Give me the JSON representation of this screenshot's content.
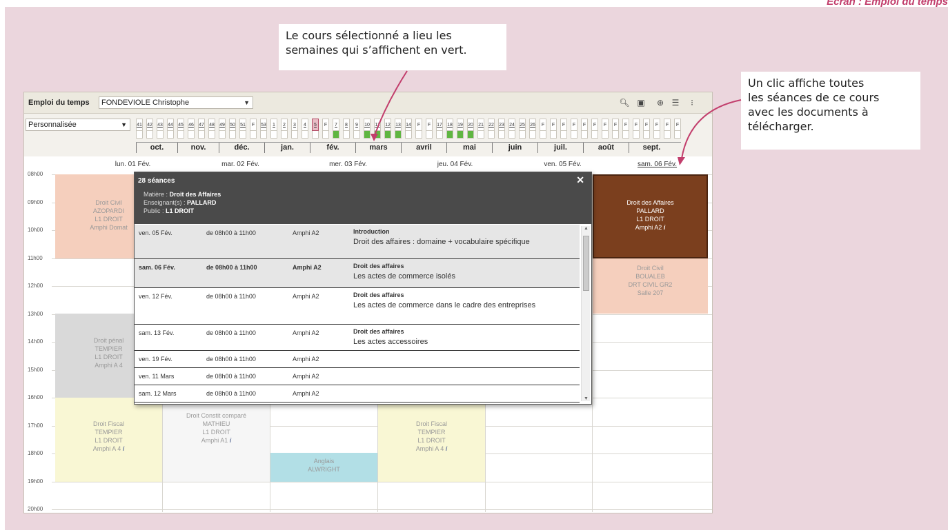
{
  "page_header": "Écran : Emploi du temps",
  "callouts": {
    "weeks": [
      "Le cours sélectionné a lieu les",
      "semaines qui s’affichent en vert."
    ],
    "click": [
      "Un clic affiche toutes",
      "les séances de ce cours",
      "avec les documents à",
      "télécharger."
    ]
  },
  "toolbar": {
    "title": "Emploi du temps",
    "teacher": "FONDEVIOLE Christophe",
    "view": "Personnalisée"
  },
  "weeks": [
    "41",
    "42",
    "43",
    "44",
    "45",
    "46",
    "47",
    "48",
    "49",
    "50",
    "51",
    "F",
    "53",
    "1",
    "2",
    "3",
    "4",
    "5",
    "F",
    "7",
    "8",
    "9",
    "10",
    "11",
    "12",
    "13",
    "14",
    "F",
    "F",
    "17",
    "18",
    "19",
    "20",
    "21",
    "22",
    "23",
    "24",
    "25",
    "26",
    "F",
    "F",
    "F",
    "F",
    "F",
    "F",
    "F",
    "F",
    "F",
    "F",
    "F",
    "F",
    "F",
    "F"
  ],
  "months": [
    "oct.",
    "nov.",
    "déc.",
    "jan.",
    "fév.",
    "mars",
    "avril",
    "mai",
    "juin",
    "juil.",
    "août",
    "sept."
  ],
  "days": [
    "lun. 01 Fév.",
    "mar. 02 Fév.",
    "mer. 03 Fév.",
    "jeu. 04 Fév.",
    "ven. 05 Fév.",
    "sam. 06 Fév."
  ],
  "hours": [
    "08h00",
    "09h00",
    "10h00",
    "11h00",
    "12h00",
    "13h00",
    "14h00",
    "15h00",
    "16h00",
    "17h00",
    "18h00",
    "19h00",
    "20h00"
  ],
  "events": {
    "mon_civil": [
      "Droit Civil",
      "AZOPARDI",
      "L1 DROIT",
      "Amphi Domat"
    ],
    "mon_penal": [
      "Droit pénal",
      "TEMPIER",
      "L1 DROIT",
      "Amphi A 4"
    ],
    "mon_fiscal": [
      "Droit Fiscal",
      "TEMPIER",
      "L1 DROIT",
      "Amphi A 4"
    ],
    "tue_constit": [
      "Droit Constit comparé",
      "MATHIEU",
      "L1 DROIT",
      "Amphi A1"
    ],
    "wed_anglais": [
      "Anglais",
      "ALWRIGHT"
    ],
    "thu_fiscal": [
      "Droit Fiscal",
      "TEMPIER",
      "L1 DROIT",
      "Amphi A 4"
    ],
    "sat_affaires": [
      "Droit des Affaires",
      "PALLARD",
      "L1 DROIT",
      "Amphi A2"
    ],
    "sat_civil": [
      "Droit Civil",
      "BOUALEB",
      "DRT CIVIL GR2",
      "Salle 207"
    ]
  },
  "popup": {
    "count": "28 séances",
    "matiere_label": "Matière :",
    "matiere": "Droit des Affaires",
    "enseignant_label": "Enseignant(s) :",
    "enseignant": "PALLARD",
    "public_label": "Public :",
    "public": "L1 DROIT",
    "close": "✕",
    "rows": [
      {
        "date": "ven. 05 Fév.",
        "time": "de 08h00 à 11h00",
        "room": "Amphi A2",
        "title": "Introduction",
        "desc": "Droit des affaires : domaine + vocabulaire spécifique"
      },
      {
        "date": "sam. 06 Fév.",
        "time": "de 08h00 à 11h00",
        "room": "Amphi A2",
        "title": "Droit des affaires",
        "desc": "Les actes de commerce isolés"
      },
      {
        "date": "ven. 12 Fév.",
        "time": "de 08h00 à 11h00",
        "room": "Amphi A2",
        "title": "Droit des affaires",
        "desc": "Les actes de commerce dans le cadre des entreprises"
      },
      {
        "date": "sam. 13 Fév.",
        "time": "de 08h00 à 11h00",
        "room": "Amphi A2",
        "title": "Droit des affaires",
        "desc": "Les actes accessoires"
      },
      {
        "date": "ven. 19 Fév.",
        "time": "de 08h00 à 11h00",
        "room": "Amphi A2",
        "title": "",
        "desc": ""
      },
      {
        "date": "ven. 11 Mars",
        "time": "de 08h00 à 11h00",
        "room": "Amphi A2",
        "title": "",
        "desc": ""
      },
      {
        "date": "sam. 12 Mars",
        "time": "de 08h00 à 11h00",
        "room": "Amphi A2",
        "title": "",
        "desc": ""
      }
    ]
  },
  "colors": {
    "green": "#5fb641",
    "brown": "#7b3f1e",
    "accent": "#c23e6c"
  }
}
